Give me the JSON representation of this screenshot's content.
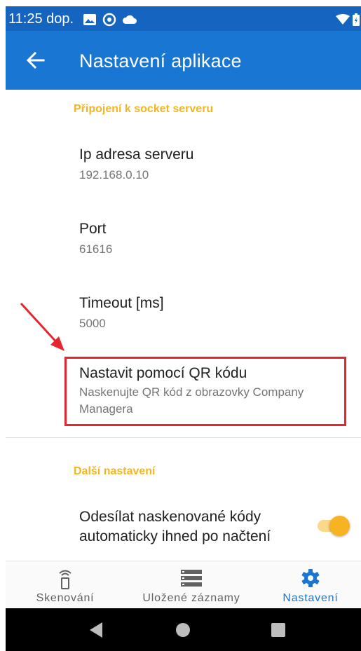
{
  "status_bar": {
    "time": "11:25 dop."
  },
  "app_bar": {
    "title": "Nastavení aplikace"
  },
  "sections": [
    {
      "header": "Připojení k socket serveru",
      "items": [
        {
          "title": "Ip adresa serveru",
          "summary": "192.168.0.10"
        },
        {
          "title": "Port",
          "summary": "61616"
        },
        {
          "title": "Timeout [ms]",
          "summary": "5000"
        },
        {
          "title": "Nastavit pomocí QR kódu",
          "summary": "Naskenujte QR kód z obrazovky Company Managera"
        }
      ]
    },
    {
      "header": "Další nastavení",
      "items": [
        {
          "title": "Odesílat naskenované kódy automaticky ihned po načtení",
          "switch_on": true
        }
      ]
    }
  ],
  "bottom_nav": [
    {
      "label": "Skenování",
      "icon": "scanner-icon",
      "selected": false
    },
    {
      "label": "Uložené záznamy",
      "icon": "list-icon",
      "selected": false
    },
    {
      "label": "Nastavení",
      "icon": "gear-icon",
      "selected": true
    }
  ],
  "colors": {
    "primary": "#1976d2",
    "status_bar": "#1565c0",
    "accent": "#f5b521",
    "annotation": "#e5252f",
    "nav_selected": "#1976d2",
    "nav_unselected": "#616161"
  }
}
